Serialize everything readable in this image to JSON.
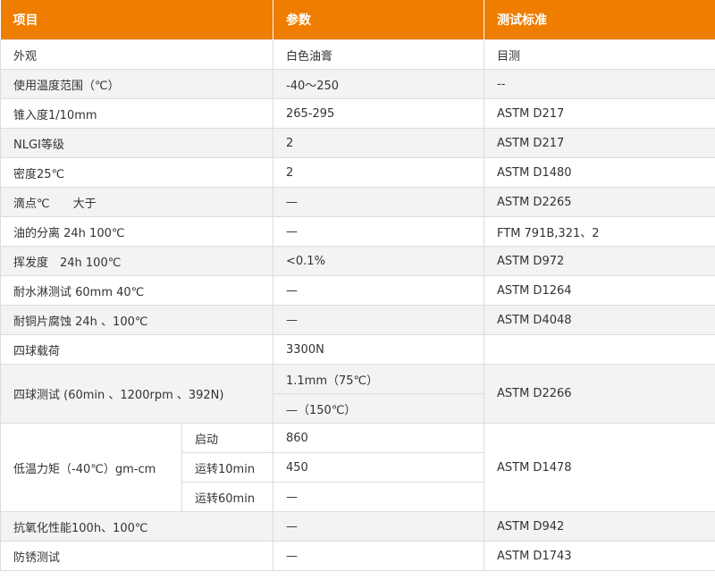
{
  "header": {
    "item": "项目",
    "param": "参数",
    "standard": "测试标准"
  },
  "rows": [
    {
      "item": "外观",
      "param": "白色油膏",
      "standard": "目测"
    },
    {
      "item": "使用温度范围（℃）",
      "param": "-40～250",
      "standard": "--"
    },
    {
      "item": "锥入度1/10mm",
      "param": "265-295",
      "standard": "ASTM D217"
    },
    {
      "item": "NLGI等级",
      "param": "2",
      "standard": "ASTM D217"
    },
    {
      "item": "密度25℃",
      "param": "2",
      "standard": "ASTM D1480"
    },
    {
      "item": "滴点℃　　大于",
      "param": "—",
      "standard": "ASTM D2265"
    },
    {
      "item": "油的分离 24h  100℃",
      "param": "—",
      "standard": "FTM 791B,321、2"
    },
    {
      "item": "挥发度　24h  100℃",
      "param": "<0.1%",
      "standard": "ASTM D972"
    },
    {
      "item": "耐水淋测试 60mm 40℃",
      "param": "—",
      "standard": "ASTM D1264"
    },
    {
      "item": "耐铜片腐蚀 24h 、100℃",
      "param": "—",
      "standard": "ASTM D4048"
    },
    {
      "item": "四球载荷",
      "param": "3300N",
      "standard": ""
    }
  ],
  "four_ball": {
    "item": "四球测试 (60min 、1200rpm 、392N)",
    "params": [
      "1.1mm（75℃）",
      "—（150℃）"
    ],
    "standard": "ASTM D2266"
  },
  "low_temp": {
    "item": "低温力矩（-40℃）gm-cm",
    "subs": [
      {
        "label": "启动",
        "param": "860"
      },
      {
        "label": "运转10min",
        "param": "450"
      },
      {
        "label": "运转60min",
        "param": "—"
      }
    ],
    "standard": "ASTM D1478"
  },
  "tail_rows": [
    {
      "item": "抗氧化性能100h、100℃",
      "param": "—",
      "standard": "ASTM D942"
    },
    {
      "item": "防锈测试",
      "param": "—",
      "standard": "ASTM D1743"
    }
  ],
  "colors": {
    "header_bg": "#ef7d00",
    "stripe_bg": "#f3f3f3",
    "border": "#dcdcdc"
  }
}
